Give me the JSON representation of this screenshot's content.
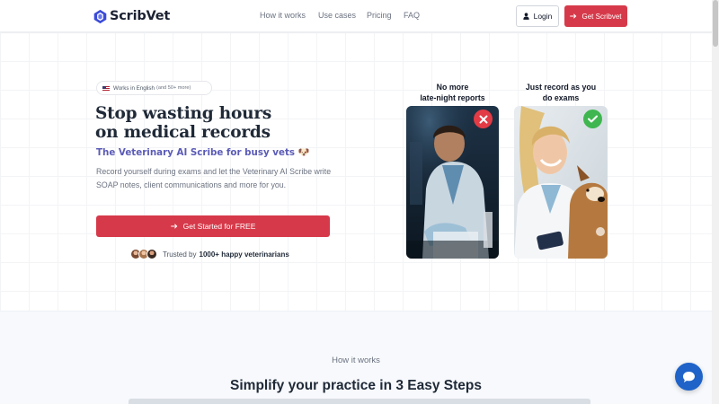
{
  "header": {
    "logo_text": "ScribVet",
    "nav": [
      "How it works",
      "Use cases",
      "Pricing",
      "FAQ"
    ],
    "login_label": "Login",
    "get_label": "Get Scribvet"
  },
  "hero": {
    "badge_main": "Works in English",
    "badge_small": "(and 50+ more)",
    "title_line1": "Stop wasting hours",
    "title_line2": "on medical records",
    "subtitle": "The Veterinary AI Scribe for busy vets 🐶",
    "description": "Record yourself during exams and let the Veterinary AI Scribe write SOAP notes, client communications and more for you.",
    "cta_label": "Get Started for FREE",
    "trusted_prefix": "Trusted by",
    "trusted_bold": "1000+ happy veterinarians"
  },
  "comparison": {
    "left_caption_1": "No more",
    "left_caption_2": "late-night reports",
    "right_caption_1": "Just record as you",
    "right_caption_2": "do exams"
  },
  "how_it_works": {
    "eyebrow": "How it works",
    "title": "Simplify your practice in 3 Easy Steps"
  },
  "icons": {
    "logo": "scribvet-logo-icon",
    "login": "user-icon",
    "arrow": "arrow-right-icon",
    "flag": "us-flag-icon",
    "bad": "x-mark-icon",
    "good": "check-mark-icon",
    "chat": "chat-bubble-icon"
  },
  "colors": {
    "brand_red": "#d63a4a",
    "accent_purple": "#5b5bb7",
    "logo_blue": "#3b4bd8",
    "bad_red": "#e23b45",
    "good_green": "#3fb650",
    "chat_blue": "#1f63c9"
  }
}
